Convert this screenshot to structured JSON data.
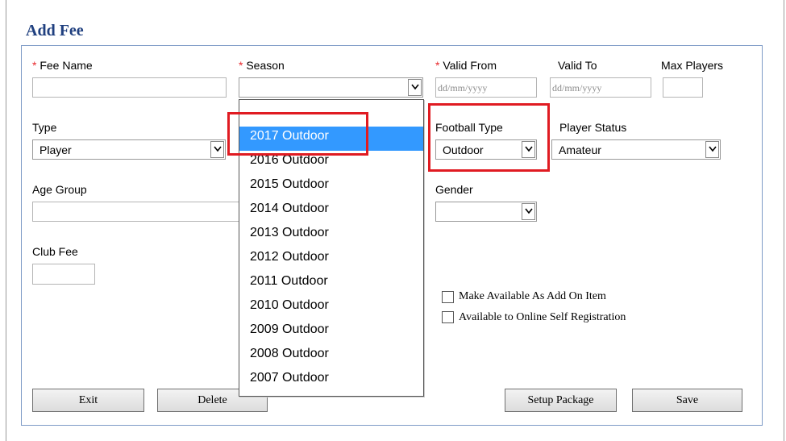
{
  "title": "Add Fee",
  "form": {
    "fee_name_label": "Fee Name",
    "season_label": "Season",
    "valid_from_label": "Valid From",
    "valid_to_label": "Valid To",
    "max_players_label": "Max Players",
    "date_placeholder": "dd/mm/yyyy",
    "type_label": "Type",
    "type_value": "Player",
    "football_type_label": "Football Type",
    "football_type_value": "Outdoor",
    "player_status_label": "Player Status",
    "player_status_value": "Amateur",
    "age_group_label": "Age Group",
    "gender_label": "Gender",
    "club_fee_label": "Club Fee",
    "required_marker": "*"
  },
  "season_dropdown": {
    "options": [
      "",
      "2017 Outdoor",
      "2016 Outdoor",
      "2015 Outdoor",
      "2014 Outdoor",
      "2013 Outdoor",
      "2012 Outdoor",
      "2011 Outdoor",
      "2010 Outdoor",
      "2009 Outdoor",
      "2008 Outdoor",
      "2007 Outdoor"
    ],
    "highlighted": "2017 Outdoor"
  },
  "checkboxes": {
    "add_on": "Make Available As Add On Item",
    "online": "Available to Online Self Registration"
  },
  "buttons": {
    "exit": "Exit",
    "delete": "Delete",
    "setup_package": "Setup Package",
    "save": "Save"
  },
  "colors": {
    "title": "#1f3f7f",
    "required": "#e8292e",
    "highlight_box": "#e01b22",
    "selected_option": "#3399ff"
  }
}
